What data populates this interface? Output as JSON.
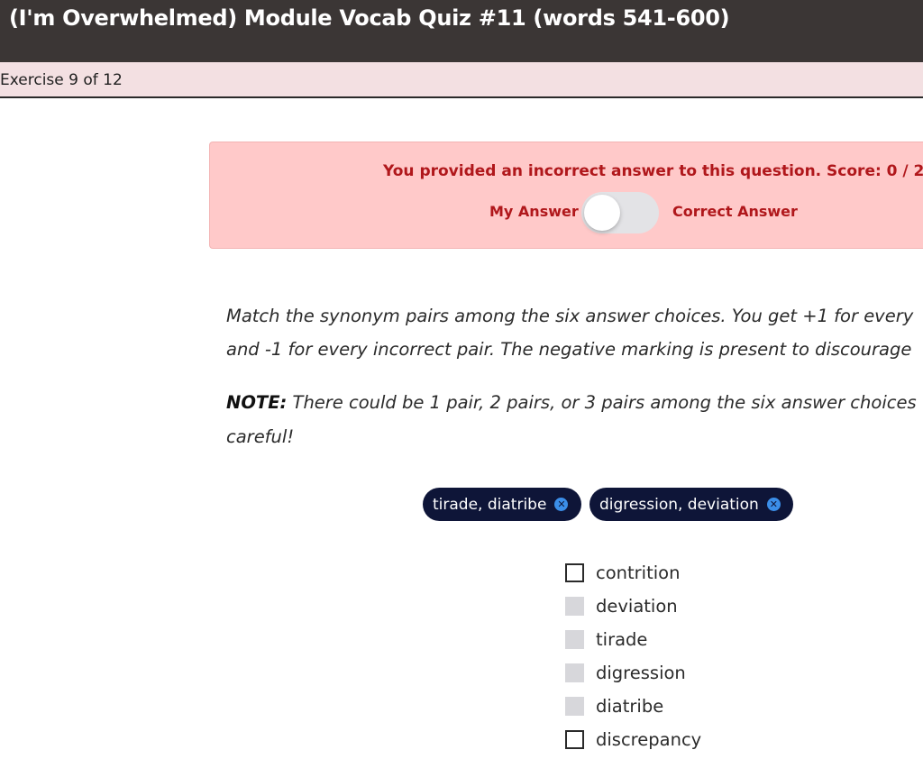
{
  "header": {
    "title": "(I'm Overwhelmed) Module Vocab Quiz #11 (words 541-600)"
  },
  "progress": {
    "label": "Exercise 9 of 12"
  },
  "feedback": {
    "message": "You provided an incorrect answer to this question. Score: 0 / 2",
    "left_label": "My Answer",
    "right_label": "Correct Answer",
    "toggle_state": "My Answer"
  },
  "instructions": {
    "line1": "Match the synonym pairs among the six answer choices. You get +1 for every",
    "line2": "and -1 for every incorrect pair. The negative marking is present to discourage",
    "note_label": "NOTE:",
    "note_line1": " There could be 1 pair, 2 pairs, or 3 pairs among the six answer choices",
    "note_line2": "careful!"
  },
  "selected_pairs": [
    {
      "label": "tirade, diatribe"
    },
    {
      "label": "digression, deviation"
    }
  ],
  "choices": [
    {
      "label": "contrition",
      "disabled": false
    },
    {
      "label": "deviation",
      "disabled": true
    },
    {
      "label": "tirade",
      "disabled": true
    },
    {
      "label": "digression",
      "disabled": true
    },
    {
      "label": "diatribe",
      "disabled": true
    },
    {
      "label": "discrepancy",
      "disabled": false
    }
  ],
  "colors": {
    "header_bg": "#3b3635",
    "subheader_bg": "#f3e0e2",
    "feedback_bg": "#ffc9c9",
    "feedback_text": "#b0171b",
    "chip_bg": "#0e1538",
    "chip_remove": "#3b8ee8"
  }
}
